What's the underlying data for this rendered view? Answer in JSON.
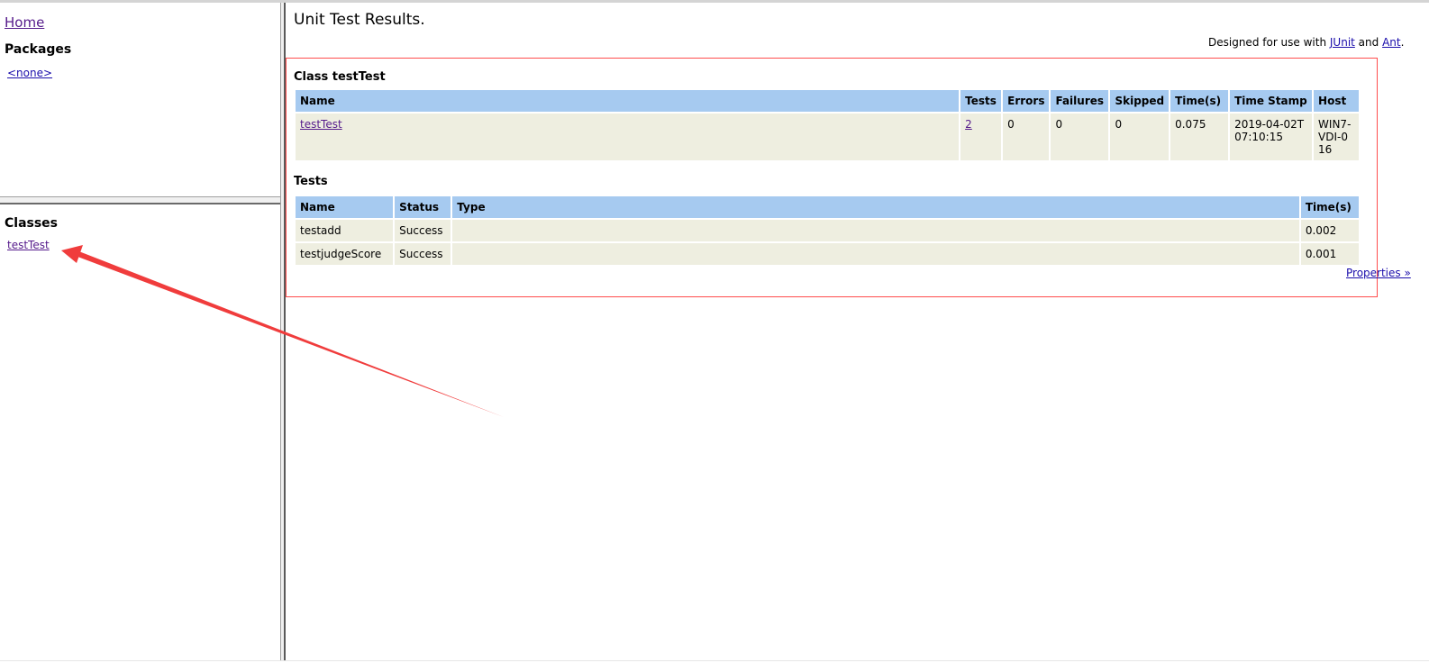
{
  "nav": {
    "home": "Home",
    "packages_heading": "Packages",
    "packages": [
      "<none>"
    ],
    "classes_heading": "Classes",
    "classes": [
      "testTest"
    ]
  },
  "main": {
    "title": "Unit Test Results.",
    "designed_prefix": "Designed for use with ",
    "junit_link": "JUnit",
    "designed_and": " and ",
    "ant_link": "Ant",
    "designed_suffix": ".",
    "class_section_title": "Class testTest",
    "class_table": {
      "headers": [
        "Name",
        "Tests",
        "Errors",
        "Failures",
        "Skipped",
        "Time(s)",
        "Time Stamp",
        "Host"
      ],
      "row": {
        "name": "testTest",
        "tests": "2",
        "errors": "0",
        "failures": "0",
        "skipped": "0",
        "time": "0.075",
        "timestamp": "2019-04-02T07:10:15",
        "host": "WIN7-VDI-016"
      }
    },
    "tests_section_title": "Tests",
    "tests_table": {
      "headers": [
        "Name",
        "Status",
        "Type",
        "Time(s)"
      ],
      "rows": [
        {
          "name": "testadd",
          "status": "Success",
          "type": "",
          "time": "0.002"
        },
        {
          "name": "testjudgeScore",
          "status": "Success",
          "type": "",
          "time": "0.001"
        }
      ]
    },
    "properties_link": "Properties »"
  },
  "annotation": {
    "arrow_color": "#f03c3c",
    "box_color": "#ff4d4d"
  }
}
